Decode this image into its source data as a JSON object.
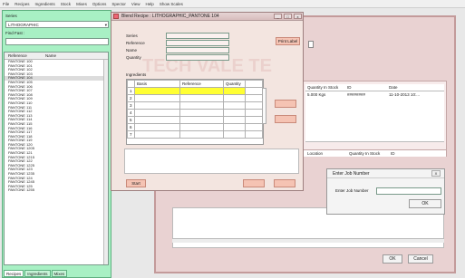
{
  "menu": [
    "File",
    "Recipes",
    "Ingredients",
    "Stock",
    "Mixes",
    "Options",
    "Spector",
    "View",
    "Help",
    "Show Scales"
  ],
  "left": {
    "series_label": "Series",
    "series_value": "LITHOGRAPHIC",
    "find_label": "Find Fast :",
    "col_reference": "Reference",
    "col_name": "Name",
    "items": [
      "PANTONE 100",
      "PANTONE 101",
      "PANTONE 102",
      "PANTONE 103",
      "PANTONE 104",
      "PANTONE 105",
      "PANTONE 106",
      "PANTONE 107",
      "PANTONE 108",
      "PANTONE 109",
      "PANTONE 110",
      "PANTONE 111",
      "PANTONE 112",
      "PANTONE 113",
      "PANTONE 114",
      "PANTONE 115",
      "PANTONE 116",
      "PANTONE 117",
      "PANTONE 118",
      "PANTONE 119",
      "PANTONE 120",
      "PANTONE 1205",
      "PANTONE 121",
      "PANTONE 1215",
      "PANTONE 122",
      "PANTONE 1225",
      "PANTONE 123",
      "PANTONE 1235",
      "PANTONE 124",
      "PANTONE 1245",
      "PANTONE 125",
      "PANTONE 1255"
    ],
    "selected_index": 4,
    "tabs": [
      "Recipes",
      "Ingredients",
      "Mixes"
    ]
  },
  "bg": {
    "col_qty": "Quantity In Stock",
    "col_id": "ID",
    "col_date": "Date",
    "row_qty": "5.000 Kgs",
    "row_id": "########",
    "row_date": "11-10-2013 10:...",
    "col_location": "Location",
    "col_qty2": "Quantity In Stock",
    "col_id2": "ID",
    "ok": "OK",
    "cancel": "Cancel"
  },
  "blend": {
    "title": "Blend Recipe : LITHOGRAPHIC_PANTONE 104",
    "series": "Series",
    "reference": "Reference",
    "name": "Name",
    "quantity": "Quantity",
    "print_label": "Print Label",
    "ingredients": "Ingredients",
    "col_basis": "Basis",
    "col_reference": "Reference",
    "col_quantity": "Quantity",
    "rows": [
      "1",
      "2",
      "3",
      "4",
      "5",
      "6",
      "7"
    ],
    "start": "Start",
    "watermark": "TECH VALE TE"
  },
  "dialog": {
    "title": "Enter Job Number",
    "label": "Enter Job Number",
    "ok": "OK",
    "close": "X"
  }
}
